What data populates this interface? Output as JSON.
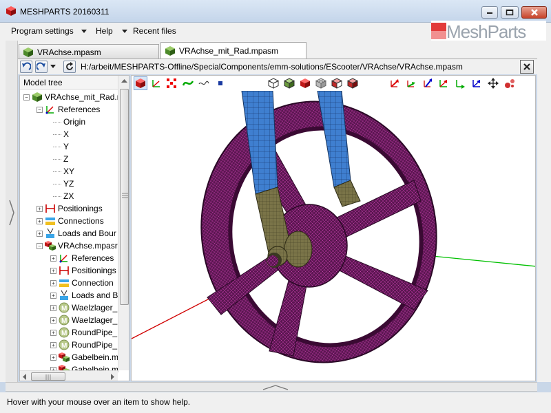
{
  "window": {
    "title": "MESHPARTS 20160311"
  },
  "menu": {
    "program_settings": "Program settings",
    "help": "Help",
    "recent_files": "Recent files"
  },
  "logo_text": "MeshParts",
  "tabs": [
    {
      "label": "VRAchse.mpasm",
      "active": false
    },
    {
      "label": "VRAchse_mit_Rad.mpasm",
      "active": true
    }
  ],
  "path": "H:/arbeit/MESHPARTS-Offline/SpecialComponents/emm-solutions/EScooter/VRAchse/VRAchse.mpasm",
  "tree": {
    "header": "Model tree",
    "items": [
      {
        "label": "VRAchse_mit_Rad.r",
        "icon": "assembly-icon",
        "expander": "−"
      },
      {
        "label": "References",
        "icon": "axes-icon",
        "expander": "−"
      },
      {
        "label": "Origin",
        "icon": "",
        "expander": ""
      },
      {
        "label": "X",
        "icon": "",
        "expander": ""
      },
      {
        "label": "Y",
        "icon": "",
        "expander": ""
      },
      {
        "label": "Z",
        "icon": "",
        "expander": ""
      },
      {
        "label": "XY",
        "icon": "",
        "expander": ""
      },
      {
        "label": "YZ",
        "icon": "",
        "expander": ""
      },
      {
        "label": "ZX",
        "icon": "",
        "expander": ""
      },
      {
        "label": "Positionings",
        "icon": "positioning-icon",
        "expander": "+"
      },
      {
        "label": "Connections",
        "icon": "connection-icon",
        "expander": "+"
      },
      {
        "label": "Loads and Bour",
        "icon": "loads-icon",
        "expander": "+"
      },
      {
        "label": "VRAchse.mpasr",
        "icon": "part-icon",
        "expander": "−"
      },
      {
        "label": "References",
        "icon": "axes-icon",
        "expander": "+"
      },
      {
        "label": "Positionings",
        "icon": "positioning-icon",
        "expander": "+"
      },
      {
        "label": "Connection",
        "icon": "connection-icon",
        "expander": "+"
      },
      {
        "label": "Loads and B",
        "icon": "loads-icon",
        "expander": "+"
      },
      {
        "label": "Waelzlager_",
        "icon": "mesh-m-icon",
        "expander": "+"
      },
      {
        "label": "Waelzlager_",
        "icon": "mesh-m-icon",
        "expander": "+"
      },
      {
        "label": "RoundPipe_",
        "icon": "mesh-m-icon",
        "expander": "+"
      },
      {
        "label": "RoundPipe_",
        "icon": "mesh-m-icon",
        "expander": "+"
      },
      {
        "label": "Gabelbein.m",
        "icon": "part-icon",
        "expander": "+"
      },
      {
        "label": "Gabelbein.m",
        "icon": "part-icon",
        "expander": "+"
      }
    ]
  },
  "toolbar_icons": [
    "solid-view-icon",
    "axes-toggle-icon",
    "nodes-icon",
    "curve-icon",
    "wave-icon",
    "point-icon",
    "wireframe-icon",
    "shaded-icon",
    "red-solid-icon",
    "mesh-icon",
    "section-icon",
    "section-edge-icon",
    "move-x-icon",
    "move-y-icon",
    "move-z-icon",
    "rotate-x-icon",
    "rotate-y-icon",
    "rotate-z-icon",
    "translate-icon",
    "explode-icon"
  ],
  "colors": {
    "mesh_wheel": "#5a1650",
    "mesh_lines": "#c03ca8",
    "fork_tube": "#3f7fd0",
    "hub": "#6e6a40",
    "axis_x": "#d00000",
    "axis_y": "#00c000",
    "axis_z": "#0000cc",
    "titlebar": "#c4d5ea"
  },
  "status": {
    "help_text": "Hover with your mouse over an item to show help."
  }
}
